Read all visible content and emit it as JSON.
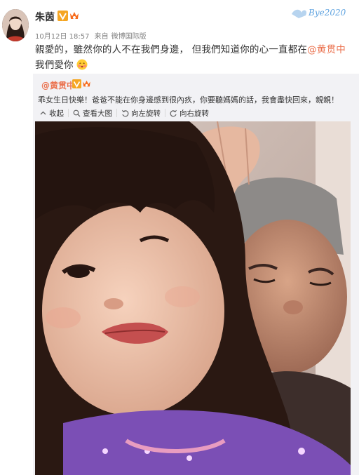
{
  "post": {
    "username": "朱茵",
    "date": "10月12日 18:57",
    "from_label": "来自",
    "source": "微博国际版",
    "text_before": "親愛的，雖然你的人不在我們身邊， 但我們知道你的心一直都在",
    "mention": "@黄贯中",
    "text_after": " 我們愛你",
    "emoji_icon": "blush-emoji-icon"
  },
  "watermark": {
    "text": "Bye2020"
  },
  "repost": {
    "original_user": "@黄贯中",
    "original_text": "乖女生日快樂！爸爸不能在你身邊感到很內疚，你要聽媽媽的話，我會盡快回來，親親！",
    "toolbar": [
      {
        "label": "收起",
        "icon": "collapse-icon"
      },
      {
        "label": "查看大图",
        "icon": "zoom-icon"
      },
      {
        "label": "向左旋转",
        "icon": "rotate-left-icon"
      },
      {
        "label": "向右旋转",
        "icon": "rotate-right-icon"
      }
    ]
  },
  "colors": {
    "link": "#eb7350",
    "text": "#333333",
    "meta": "#808080",
    "repost_bg": "#f2f2f5"
  }
}
